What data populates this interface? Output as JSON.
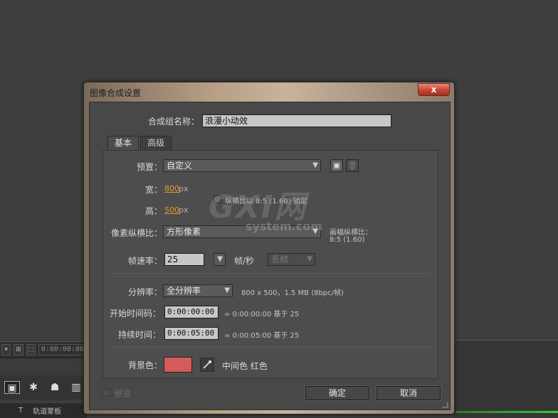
{
  "background": {
    "timecode": "0:00:00:00",
    "panel_label": "轨道蒙板",
    "track_mark": "T"
  },
  "dialog": {
    "title": "图像合成设置",
    "close": "x",
    "comp_name_label": "合成组名称：",
    "comp_name_value": "浪漫小动效",
    "tabs": [
      "基本",
      "高级"
    ],
    "preset_label": "预置：",
    "preset_value": "自定义",
    "width_label": "宽：",
    "width_value": "800",
    "height_label": "高：",
    "height_value": "500",
    "unit_px": "px",
    "lock_aspect_label": "纵横比以 8:5 (1.60) 锁定",
    "pixel_aspect_label": "像素纵横比：",
    "pixel_aspect_value": "方形像素",
    "frame_aspect_label": "画幅纵横比：",
    "frame_aspect_value": "8:5 (1.60)",
    "frame_rate_label": "帧速率：",
    "frame_rate_value": "25",
    "fps_unit": "帧/秒",
    "drop_frame_value": "丢帧",
    "resolution_label": "分辨率：",
    "resolution_value": "全分辨率",
    "resolution_info": "800 x 500，1.5 MB (8bpc/帧)",
    "start_tc_label": "开始时间码：",
    "start_tc_value": "0:00:00:00",
    "start_tc_info": "= 0:00:00:00  基于 25",
    "duration_label": "持续时间：",
    "duration_value": "0:00:05:00",
    "duration_info": "= 0:00:05:00  基于 25",
    "bg_color_label": "背景色：",
    "bg_color_hex": "#d55a5a",
    "bg_color_name": "中间色 红色",
    "preview_label": "预览",
    "ok_label": "确定",
    "cancel_label": "取消"
  },
  "watermark": {
    "big": "GXI网",
    "small": "system.com"
  },
  "colors": {
    "accent_orange": "#e79b28",
    "close_red": "#c64632"
  }
}
